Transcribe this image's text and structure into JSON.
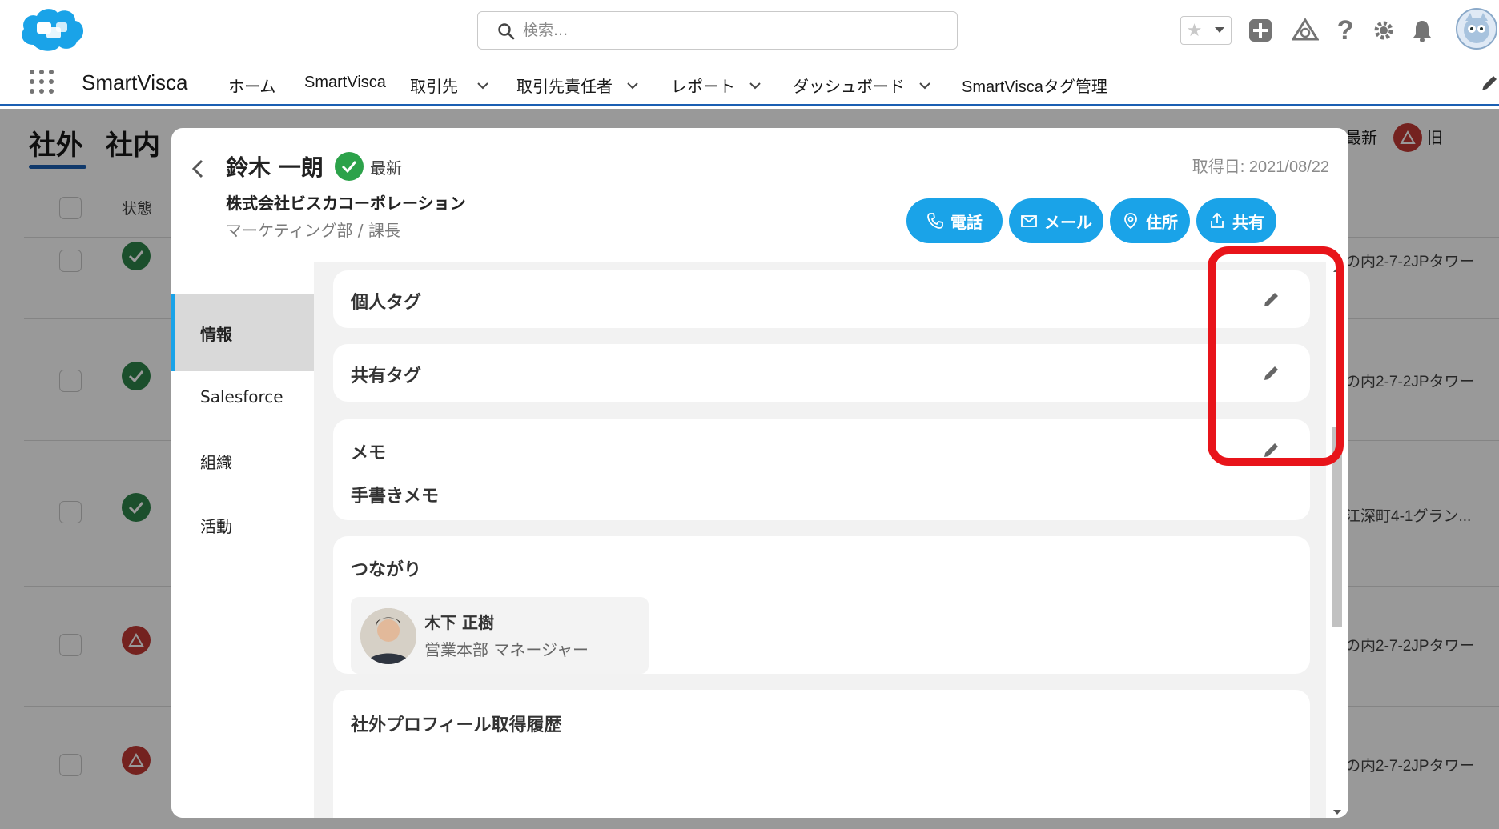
{
  "header": {
    "search_placeholder": "検索...",
    "icons": [
      "favorite-star-icon",
      "add-icon",
      "trailhead-icon",
      "help-icon",
      "settings-icon",
      "notification-bell-icon",
      "user-avatar"
    ]
  },
  "nav": {
    "app_name": "SmartVisca",
    "items": [
      {
        "label": "ホーム",
        "dropdown": false
      },
      {
        "label": "SmartVisca",
        "dropdown": false
      },
      {
        "label": "取引先",
        "dropdown": true
      },
      {
        "label": "取引先責任者",
        "dropdown": true
      },
      {
        "label": "レポート",
        "dropdown": true
      },
      {
        "label": "ダッシュボード",
        "dropdown": true
      },
      {
        "label": "SmartViscaタグ管理",
        "dropdown": false
      }
    ]
  },
  "background": {
    "tabs": [
      "社外",
      "社内"
    ],
    "status_header": "状態",
    "legend_latest": "最新",
    "legend_old": "旧",
    "rows": [
      {
        "status": "ok",
        "address": "の内2-7-2JPタワー"
      },
      {
        "status": "ok",
        "address": "の内2-7-2JPタワー"
      },
      {
        "status": "ok",
        "address": "江深町4-1グラン..."
      },
      {
        "status": "old",
        "address": "の内2-7-2JPタワー"
      },
      {
        "status": "old",
        "address": "の内2-7-2JPタワー"
      }
    ]
  },
  "modal": {
    "name": "鈴木 一朗",
    "badge": "最新",
    "company": "株式会社ビスカコーポレーション",
    "dept": "マーケティング部 / 課長",
    "acquired": "取得日: 2021/08/22",
    "actions": {
      "phone": "電話",
      "mail": "メール",
      "address": "住所",
      "share": "共有"
    },
    "sidenav": [
      "情報",
      "Salesforce",
      "組織",
      "活動"
    ],
    "cards": {
      "personal_tag": "個人タグ",
      "shared_tag": "共有タグ",
      "memo": "メモ",
      "handwritten_memo": "手書きメモ",
      "connections": "つながり",
      "history": "社外プロフィール取得履歴"
    },
    "connection": {
      "name": "木下 正樹",
      "role": "営業本部 マネージャー"
    }
  },
  "colors": {
    "accent_blue": "#1aa3e8",
    "nav_border": "#1b5fb3",
    "ok_green": "#2ca24a",
    "warn_red": "#c23934",
    "highlight_red": "#e8141a"
  }
}
